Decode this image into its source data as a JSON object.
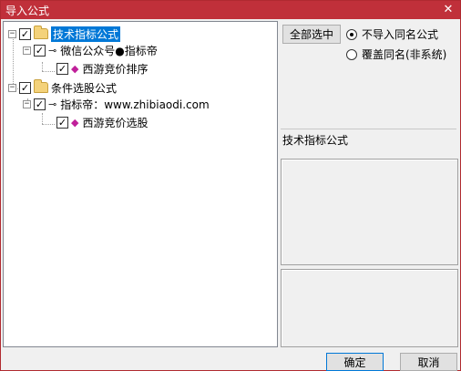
{
  "window": {
    "title": "导入公式",
    "close_glyph": "✕"
  },
  "tree": {
    "nodes": [
      {
        "label": "技术指标公式",
        "checked": true,
        "selected": true
      },
      {
        "label": "微信公众号●指标帝",
        "checked": true
      },
      {
        "label": "西游竞价排序",
        "checked": true
      },
      {
        "label": "条件选股公式",
        "checked": true
      },
      {
        "label": "指标帝：www.zhibiaodi.com",
        "checked": true
      },
      {
        "label": "西游竞价选股",
        "checked": true
      }
    ],
    "expander_glyph": "−",
    "check_glyph": "✓",
    "key_glyph": "⊸",
    "gem_glyph": "◆"
  },
  "right": {
    "select_all_label": "全部选中",
    "radio_no_import": "不导入同名公式",
    "radio_overwrite": "覆盖同名(非系统)",
    "selected_option": "no_import",
    "category_label": "技术指标公式"
  },
  "footer": {
    "ok_label": "确定",
    "cancel_label": "取消"
  },
  "colors": {
    "titlebar": "#c0303a",
    "selection": "#0078d7",
    "folder": "#f4d27a",
    "gem": "#c0209a"
  }
}
